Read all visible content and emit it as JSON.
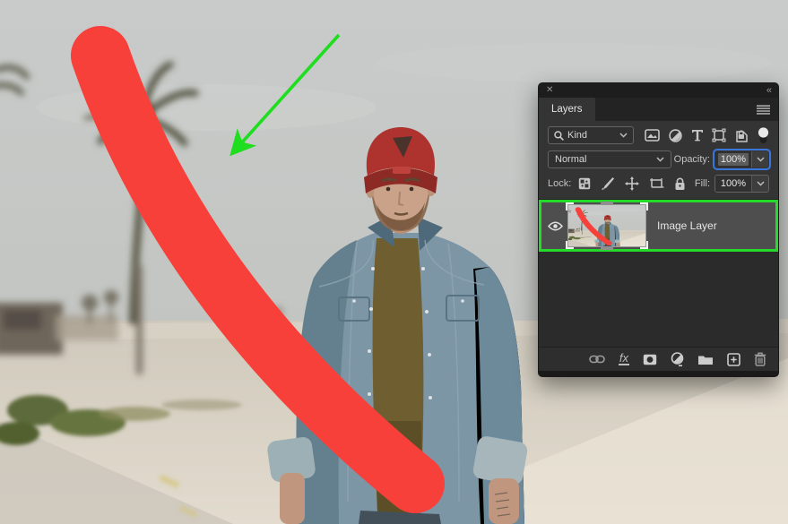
{
  "app": {
    "name": "Photoshop Layers panel over beach photo"
  },
  "colors": {
    "accent_blue": "#3a77dd",
    "annotation_green": "#1fdd1f",
    "selection_green": "#26da2b",
    "brush_red": "#f8403a",
    "panel_bg": "#343434"
  },
  "canvas": {
    "description": "Photo of man in red backwards cap and denim jacket on beach",
    "annotations": [
      "red-brush-stroke",
      "green-arrow",
      "green-layer-highlight"
    ]
  },
  "panel": {
    "close_glyph": "✕",
    "collapse_glyph": "«",
    "tab_label": "Layers",
    "filter": {
      "search_label": "Kind",
      "icons": [
        "pixel-layer-filter",
        "adjustment-layer-filter",
        "type-layer-filter",
        "shape-layer-filter",
        "smart-object-filter",
        "filter-toggle"
      ]
    },
    "blend": {
      "mode": "Normal",
      "opacity_label": "Opacity:",
      "opacity_value": "100%"
    },
    "lock": {
      "label": "Lock:",
      "icons": [
        "lock-transparent-pixels",
        "lock-image-pixels",
        "lock-position",
        "lock-artboard",
        "lock-all"
      ],
      "fill_label": "Fill:",
      "fill_value": "100%"
    },
    "layers": [
      {
        "name": "Image Layer",
        "visible": true,
        "selected": true
      }
    ],
    "footer": {
      "fx_label": "fx",
      "icons": [
        "link-layers",
        "layer-style-fx",
        "add-layer-mask",
        "new-adjustment-layer",
        "new-group",
        "new-layer",
        "delete-layer"
      ]
    }
  }
}
